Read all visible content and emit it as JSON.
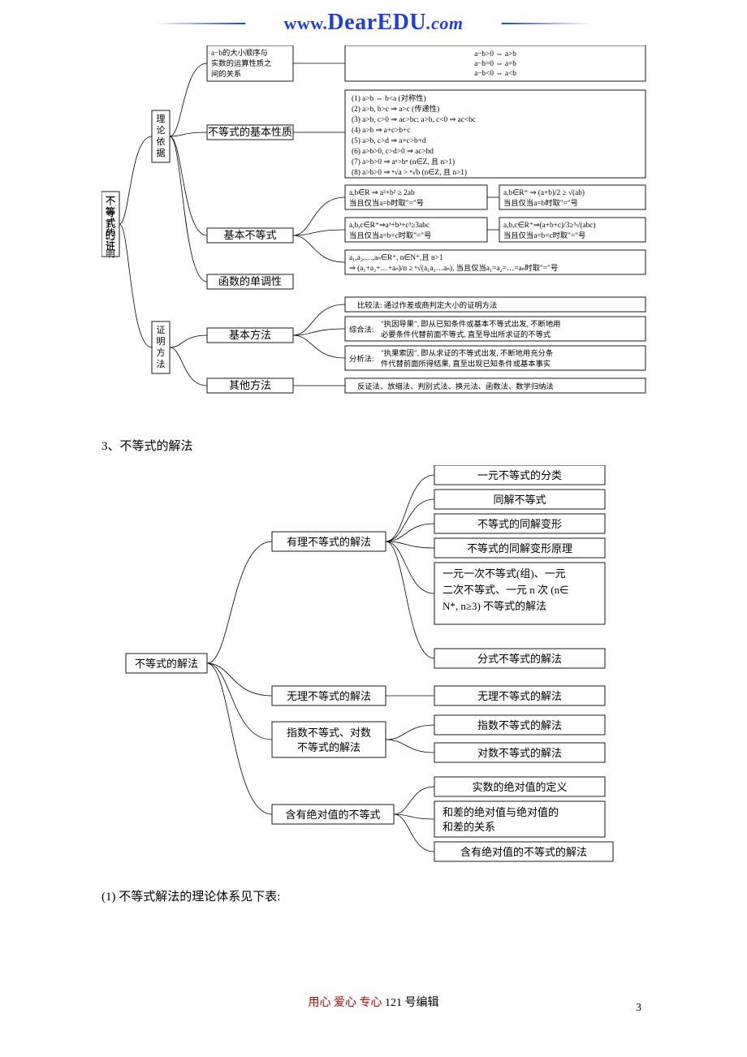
{
  "header": {
    "url_prefix": "www.",
    "url_main": "DearEDU",
    "url_suffix": ".com"
  },
  "diagram1": {
    "root": "不等式的证明",
    "b1": "理论依据",
    "b2": "证明方法",
    "b1_1_label": "a−b的大小顺序与实数的运算性质之间的关系",
    "b1_1_detail": [
      "a−b>0 ⇔ a>b",
      "a−b=0 ⇔ a=b",
      "a−b<0 ⇔ a<b"
    ],
    "b1_2_label": "不等式的基本性质",
    "b1_2_detail": [
      "(1) a>b ⇔ b<a (对称性)",
      "(2) a>b, b>c ⇒ a>c (传递性)",
      "(3) a>b, c>0 ⇒ ac>bc; a>b, c<0 ⇒ ac<bc",
      "(4) a>b ⇒ a+c>b+c",
      "(5) a>b, c>d ⇒ a+c>b+d",
      "(6) a>b>0, c>d>0 ⇒ ac>bd",
      "(7) a>b>0 ⇒ aⁿ>bⁿ (n∈Z, 且 n>1)",
      "(8) a>b>0 ⇒ ⁿ√a > ⁿ√b (n∈Z, 且 n>1)"
    ],
    "b1_3_label": "基本不等式",
    "b1_3_r1a": "a,b∈R ⇒ a²+b² ≥ 2ab\n当且仅当 a=b 时取\"=\"号",
    "b1_3_r1b": "a,b∈R⁺ ⇒ (a+b)/2 ≥ √(ab)\n当且仅当 a=b 时取\"=\"号",
    "b1_3_r2a": "a,b,c∈R⁺ ⇒ a³+b³+c³ ≥ 3abc\n当且仅当 a=b=c 时取\"=\"号",
    "b1_3_r2b": "a,b,c∈R⁺ ⇒ (a+b+c)/3 ≥ ³√(abc)\n当且仅当 a=b=c 时取\"=\"号",
    "b1_3_r3": "a₁,a₂,…,aₙ∈R⁺, n∈N⁺, 且 n>1\n⇒ (a₁+a₂+…+aₙ)/n ≥ ⁿ√(a₁a₂…aₙ), 当且仅当 a₁=a₂=…=aₙ 时取\"=\"号",
    "b1_4_label": "函数的单调性",
    "b2_1_label": "基本方法",
    "b2_1_r1": "比较法: 通过作差或商判定大小的证明方法",
    "b2_1_r2_t": "综合法:",
    "b2_1_r2": "\"执因导果\", 即从已知条件或基本不等式出发, 不断地用必要条件代替前面不等式, 直至导出所求证的不等式",
    "b2_1_r3_t": "分析法:",
    "b2_1_r3": "\"执果索因\", 即从求证的不等式出发, 不断地用充分条件代替前面所得结果, 直至出现已知条件或基本事实",
    "b2_2_label": "其他方法",
    "b2_2_r": "反证法、放缩法、判别式法、换元法、函数法、数学归纳法"
  },
  "section3_title": "3、不等式的解法",
  "diagram2": {
    "root": "不等式的解法",
    "c1": "有理不等式的解法",
    "c1_items": [
      "一元不等式的分类",
      "同解不等式",
      "不等式的同解变形",
      "不等式的同解变形原理",
      "一元一次不等式(组)、一元二次不等式、一元 n 次 (n∈N*, n≥3) 不等式的解法",
      "分式不等式的解法"
    ],
    "c2": "无理不等式的解法",
    "c2_r": "无理不等式的解法",
    "c3": "指数不等式、对数不等式的解法",
    "c3_items": [
      "指数不等式的解法",
      "对数不等式的解法"
    ],
    "c4": "含有绝对值的不等式",
    "c4_items": [
      "实数的绝对值的定义",
      "和差的绝对值与绝对值的和差的关系",
      "含有绝对值的不等式的解法"
    ]
  },
  "bottom_note": "(1) 不等式解法的理论体系见下表:",
  "footer": {
    "red": "用心  爱心  专心",
    "gray": "  121 号编辑",
    "page": "3"
  }
}
